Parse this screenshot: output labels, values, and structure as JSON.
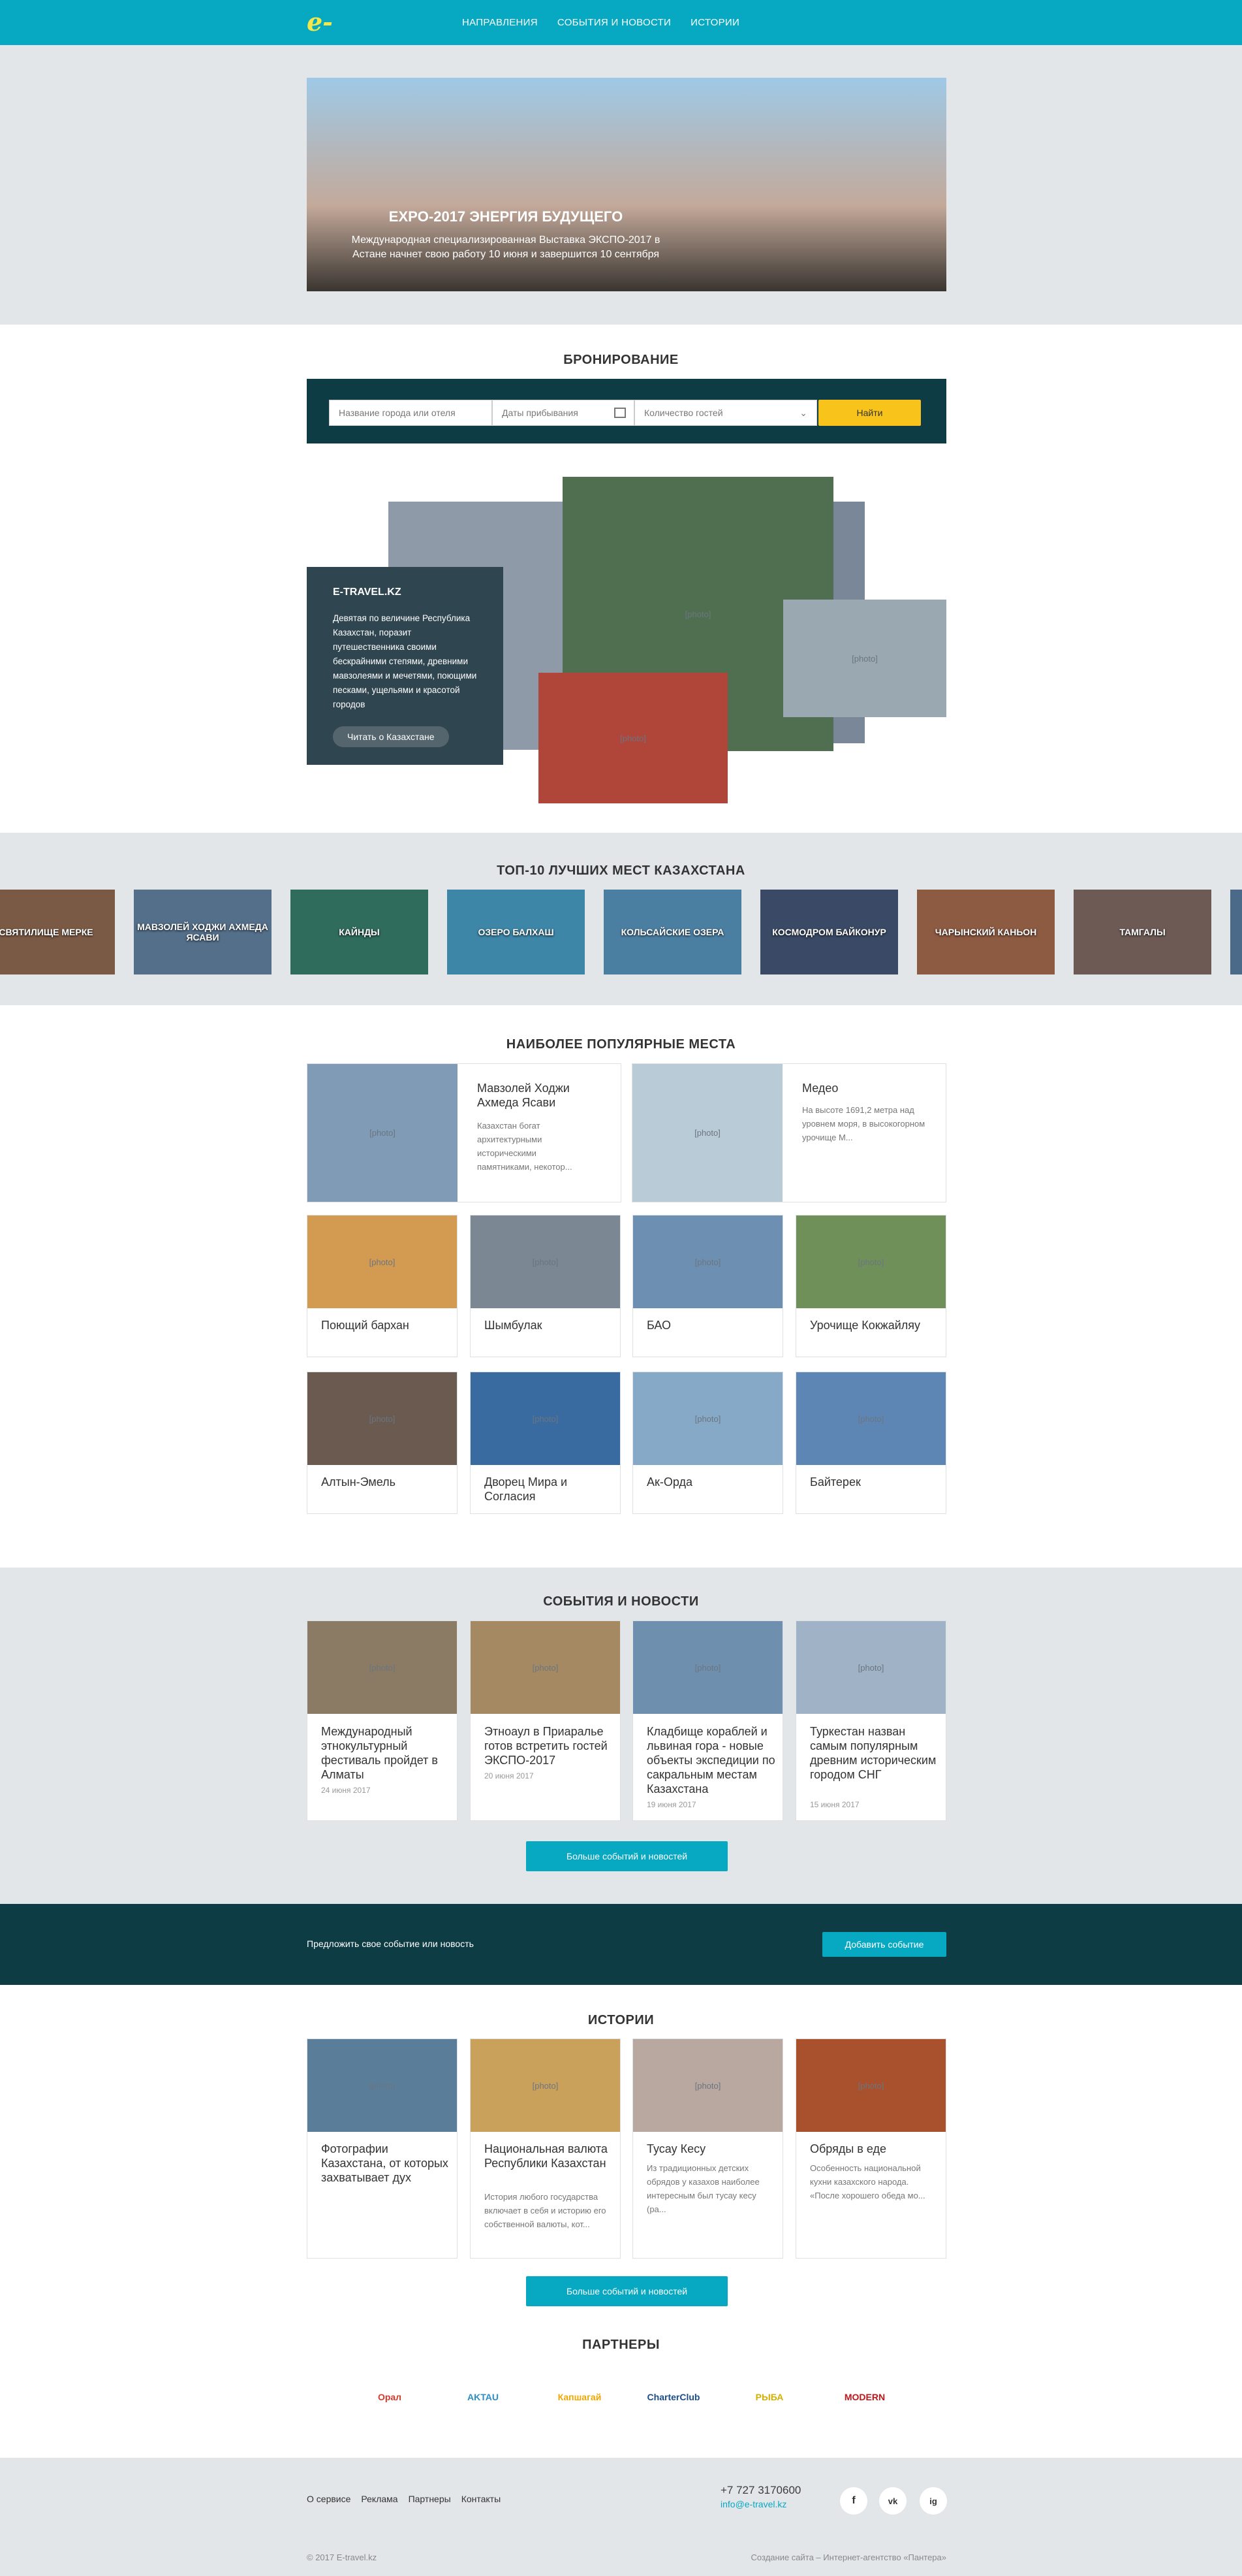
{
  "header": {
    "logo": "e-travel.kz",
    "nav": [
      "НАПРАВЛЕНИЯ",
      "СОБЫТИЯ И НОВОСТИ",
      "ИСТОРИИ"
    ]
  },
  "hero": {
    "title": "EXPO-2017 ЭНЕРГИЯ БУДУЩЕГО",
    "text": "Международная специализированная Выставка ЭКСПО-2017 в Астане начнет свою работу 10 июня и завершится 10 сентября"
  },
  "booking": {
    "title": "БРОНИРОВАНИЕ",
    "city_placeholder": "Название города или отеля",
    "date_placeholder": "Даты прибывания",
    "guests_placeholder": "Количество гостей",
    "search_label": "Найти"
  },
  "about": {
    "title": "E-TRAVEL.KZ",
    "text": "Девятая по величине Республика Казахстан, поразит путешественника своими бескрайними степями, древними мавзолеями и мечетями, поющими песками, ущельями и красотой городов",
    "button": "Читать о Казахстане"
  },
  "top10": {
    "title": "ТОП-10 ЛУЧШИХ МЕСТ КАЗАХСТАНА",
    "items": [
      "СВЯТИЛИЩЕ МЕРКЕ",
      "МАВЗОЛЕЙ ХОДЖИ АХМЕДА ЯСАВИ",
      "КАЙНДЫ",
      "ОЗЕРО БАЛХАШ",
      "КОЛЬСАЙСКИЕ ОЗЕРА",
      "КОСМОДРОМ БАЙКОНУР",
      "ЧАРЫНСКИЙ КАНЬОН",
      "ТАМГАЛЫ"
    ]
  },
  "popular": {
    "title": "НАИБОЛЕЕ ПОПУЛЯРНЫЕ МЕСТА",
    "featured": [
      {
        "title": "Мавзолей Ходжи Ахмеда Ясави",
        "desc": "Казахстан богат архитектурными историческими памятниками, некотор..."
      },
      {
        "title": "Медео",
        "desc": "На высоте 1691,2 метра над уровнем моря, в высокогорном урочище М..."
      }
    ],
    "places": [
      "Поющий бархан",
      "Шымбулак",
      "БАО",
      "Урочище Кокжайляу",
      "Алтын-Эмель",
      "Дворец Мира и Согласия",
      "Ак-Орда",
      "Байтерек"
    ]
  },
  "events": {
    "title": "СОБЫТИЯ И НОВОСТИ",
    "items": [
      {
        "title": "Международный этнокультурный фестиваль пройдет в Алматы",
        "date": "24 июня 2017"
      },
      {
        "title": "Этноаул в Приаралье готов встретить гостей ЭКСПО-2017",
        "date": "20 июня 2017"
      },
      {
        "title": "Кладбище кораблей и львиная гора - новые объекты экспедиции по сакральным местам Казахстана",
        "date": "19 июня 2017"
      },
      {
        "title": "Туркестан назван самым популярным древним историческим городом СНГ",
        "date": "15 июня 2017"
      }
    ],
    "more": "Больше событий и новостей"
  },
  "suggest": {
    "text": "Предложить свое событие или новость",
    "button": "Добавить событие"
  },
  "stories": {
    "title": "ИСТОРИИ",
    "items": [
      {
        "title": "Фотографии Казахстана, от которых захватывает дух",
        "desc": ""
      },
      {
        "title": "Национальная валюта Республики Казахстан",
        "desc": "История любого государства включает в себя и историю его собственной валюты, кот..."
      },
      {
        "title": "Тусау Кесу",
        "desc": "Из традиционных детских обрядов у казахов наиболее интересным был тусау кесу (ра..."
      },
      {
        "title": "Обряды в еде",
        "desc": "Особенность национальной кухни казахского народа. «После хорошего обеда мо..."
      }
    ],
    "more": "Больше событий и новостей"
  },
  "partners": {
    "title": "ПАРТНЕРЫ",
    "items": [
      "Орал",
      "AKTAU",
      "Капшагай",
      "CharterClub",
      "РЫБА",
      "MODERN"
    ]
  },
  "footer": {
    "links": [
      "О сервисе",
      "Реклама",
      "Партнеры",
      "Контакты"
    ],
    "phone": "+7 727 3170600",
    "email": "info@e-travel.kz",
    "copyright": "© 2017 E-travel.kz",
    "credit": "Создание сайта – Интернет-агентство «Пантера»",
    "social": [
      "f",
      "vk",
      "ig"
    ]
  }
}
